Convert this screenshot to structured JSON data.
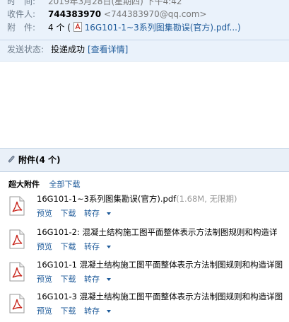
{
  "header": {
    "time_label": "时　间:",
    "time_value": "2019年3月28日(星期四) 下午4:42",
    "recipient_label": "收件人:",
    "recipient_name": "744383970",
    "recipient_email": "<744383970@qq.com>",
    "attach_label": "附　件:",
    "attach_count": "4 个 (",
    "attach_first": "16G101-1~3系列图集勘误(官方).pdf...)"
  },
  "status": {
    "label": "发送状态:",
    "value": "投递成功",
    "detail_link": "[查看详情]"
  },
  "attachments": {
    "title": "附件(4 个)",
    "section_label": "超大附件",
    "download_all": "全部下载",
    "items": [
      {
        "name": "16G101-1~3系列图集勘误(官方).pdf",
        "size": "(1.68M, 无限期)"
      },
      {
        "name": "16G101-2: 混凝土结构施工图平面整体表示方法制图规则和构造详",
        "size": ""
      },
      {
        "name": "16G101-1 混凝土结构施工图平面整体表示方法制图规则和构造详图",
        "size": ""
      },
      {
        "name": "16G101-3 混凝土结构施工图平面整体表示方法制图规则和构造详图",
        "size": ""
      }
    ],
    "actions": {
      "preview": "预览",
      "download": "下载",
      "forward": "转存"
    }
  }
}
